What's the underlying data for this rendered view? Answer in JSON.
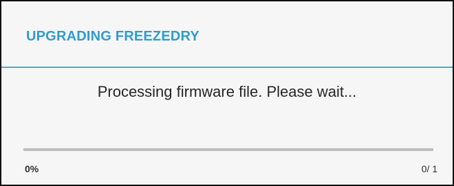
{
  "dialog": {
    "title": "UPGRADING FREEZEDRY",
    "message": "Processing firmware file. Please wait...",
    "progress": {
      "fraction": 0,
      "percent_label": "0%",
      "count_label": "0/ 1"
    },
    "colors": {
      "accent": "#2f9ccd",
      "track": "#bdbdbd",
      "background": "#f6f6f6"
    }
  }
}
